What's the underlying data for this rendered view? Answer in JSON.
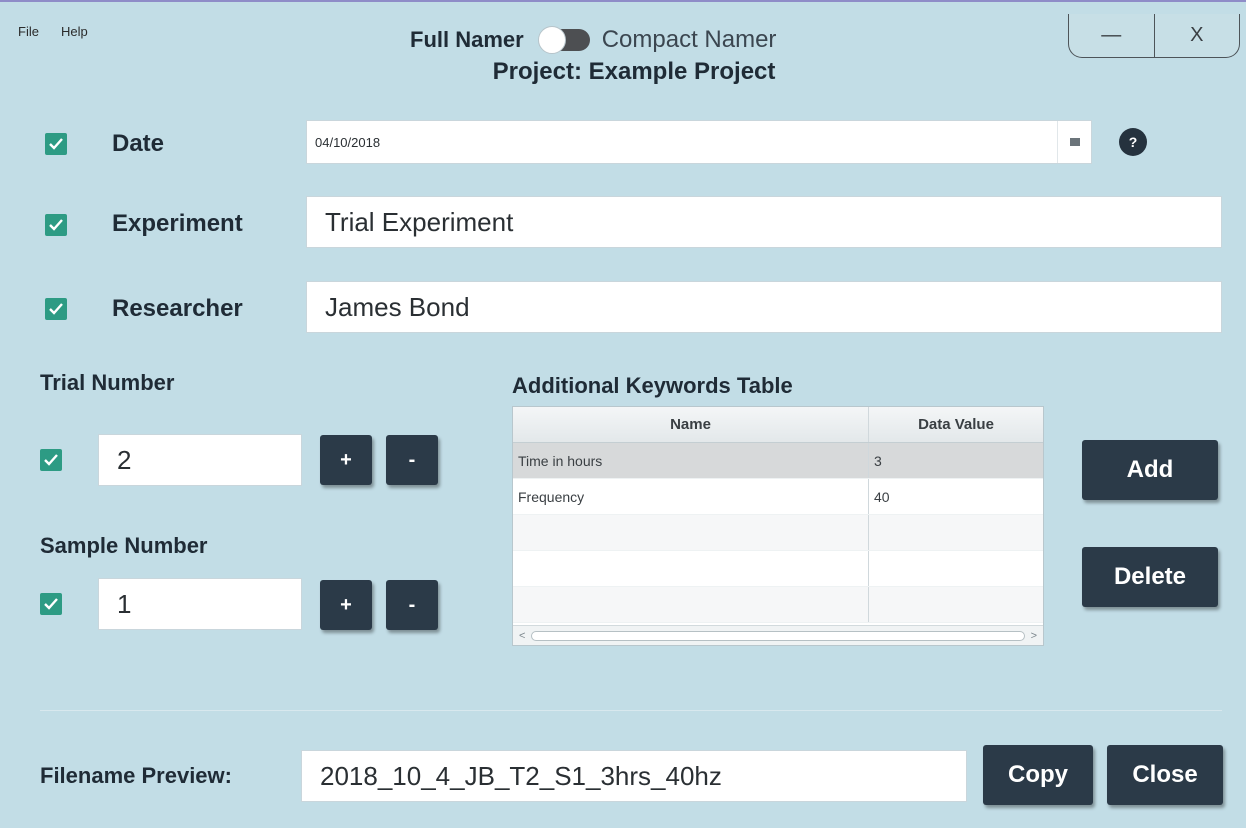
{
  "menu": {
    "file": "File",
    "help": "Help"
  },
  "mode_toggle": {
    "left_label": "Full Namer",
    "right_label": "Compact Namer"
  },
  "window_controls": {
    "minimize": "—",
    "close": "X"
  },
  "project_title": "Project: Example Project",
  "fields": {
    "date": {
      "label": "Date",
      "value": "04/10/2018",
      "checked": true
    },
    "experiment": {
      "label": "Experiment",
      "value": "Trial Experiment",
      "checked": true
    },
    "researcher": {
      "label": "Researcher",
      "value": "James Bond",
      "checked": true
    }
  },
  "help_icon": "?",
  "trial": {
    "label": "Trial Number",
    "value": "2",
    "plus": "+",
    "minus": "-"
  },
  "sample": {
    "label": "Sample Number",
    "value": "1",
    "plus": "+",
    "minus": "-"
  },
  "keywords": {
    "title": "Additional Keywords Table",
    "columns": [
      "Name",
      "Data Value"
    ],
    "rows": [
      {
        "name": "Time in hours",
        "value": "3"
      },
      {
        "name": "Frequency",
        "value": "40"
      },
      {
        "name": "",
        "value": ""
      },
      {
        "name": "",
        "value": ""
      },
      {
        "name": "",
        "value": ""
      }
    ],
    "scroll_left": "<",
    "scroll_right": ">"
  },
  "buttons": {
    "add": "Add",
    "delete": "Delete",
    "copy": "Copy",
    "close": "Close"
  },
  "preview": {
    "label": "Filename Preview:",
    "value": "2018_10_4_JB_T2_S1_3hrs_40hz"
  }
}
